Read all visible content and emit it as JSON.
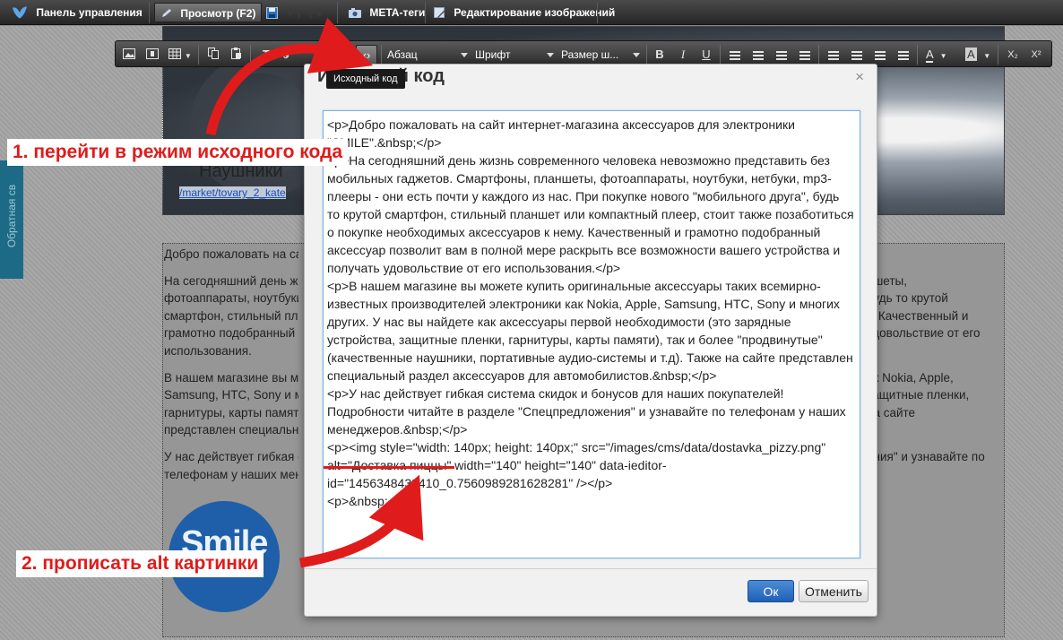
{
  "topbar": {
    "items": [
      {
        "label": "Панель управления",
        "icon": "logo-bird-icon"
      },
      {
        "label": "Просмотр (F2)",
        "icon": "pen-icon"
      },
      {
        "label": "META-теги",
        "icon": "camera-icon"
      },
      {
        "label": "Редактирование изображений",
        "icon": "image-edit-icon"
      }
    ],
    "save_icon": "save-icon",
    "undo_icon": "undo-icon",
    "redo_icon": "redo-icon"
  },
  "page": {
    "hero_title": "Наушники",
    "hero_link": "/market/tovary_2_kate",
    "feedback_tab": "Обратная св",
    "content_left": [
      "Добро пожаловать на са",
      "На сегодняшний день жи",
      "фотоаппараты, ноутбуки",
      "смартфон, стильный пла",
      "грамотно подобранный а",
      "использования.",
      "В нашем магазине вы м",
      "Samsung, HTC, Sony и м",
      "гарнитуры, карты памят",
      "представлен специальн",
      "У нас действует гибкая с",
      "телефонам у наших мене"
    ],
    "content_right": [
      "ншеты,",
      "будь то крутой",
      "у. Качественный и",
      "удовольствие от его",
      "ак Nokia, Apple,",
      "защитные пленки,",
      "на сайте",
      "ения\" и узнавайте по"
    ],
    "logo_text": "Smile"
  },
  "editor_toolbar": {
    "paragraph_select": "Абзац",
    "font_select": "Шрифт",
    "size_select": "Размер ш...",
    "bold": "B",
    "italic": "I",
    "underline": "U",
    "source_button": "‹›",
    "text_color": "A",
    "bg_color": "A",
    "subscript": "X₂",
    "superscript": "X²"
  },
  "tooltip": "Исходный код",
  "dialog": {
    "title": "Исходный код",
    "close": "×",
    "source": "<p>Добро пожаловать на сайт интернет-магазина аксессуаров для электроники \"SMILE\".&nbsp;</p>\n<p>На сегодняшний день жизнь современного человека невозможно представить без мобильных гаджетов. Смартфоны, планшеты, фотоаппараты, ноутбуки, нетбуки, mp3-плееры - они есть почти у каждого из нас. При покупке нового \"мобильного друга\", будь то крутой смартфон, стильный планшет или компактный плеер, стоит также позаботиться о покупке необходимых аксессуаров к нему. Качественный и грамотно подобранный аксессуар позволит вам в полной мере раскрыть все возможности вашего устройства и получать удовольствие от его использования.</p>\n<p>В нашем магазине вы можете купить оригинальные аксессуары таких всемирно-известных производителей электроники как Nokia, Apple, Samsung, HTC, Sony и многих других. У нас вы найдете как аксессуары первой необходимости (это зарядные устройства, защитные пленки, гарнитуры, карты памяти), так и более \"продвинутые\" (качественные наушники, портативные аудио-системы и т.д). Также на сайте представлен специальный раздел аксессуаров для автомобилистов.&nbsp;</p>\n<p>У нас действует гибкая система скидок и бонусов для наших покупателей! Подробности читайте в разделе \"Спецпредложения\" и узнавайте по телефонам у наших менеджеров.&nbsp;</p>\n<p><img style=\"width: 140px; height: 140px;\" src=\"/images/cms/data/dostavka_pizzy.png\" alt=\"Доставка пиццы\" width=\"140\" height=\"140\" data-ieditor-id=\"1456348439410_0.7560989281628281\" /></p>\n<p>&nbsp;</p>",
    "ok_label": "Ок",
    "cancel_label": "Отменить"
  },
  "annotations": {
    "step1": "1. перейти в режим исходного кода",
    "step2": "2. прописать alt картинки",
    "color": "#e01b1b"
  }
}
